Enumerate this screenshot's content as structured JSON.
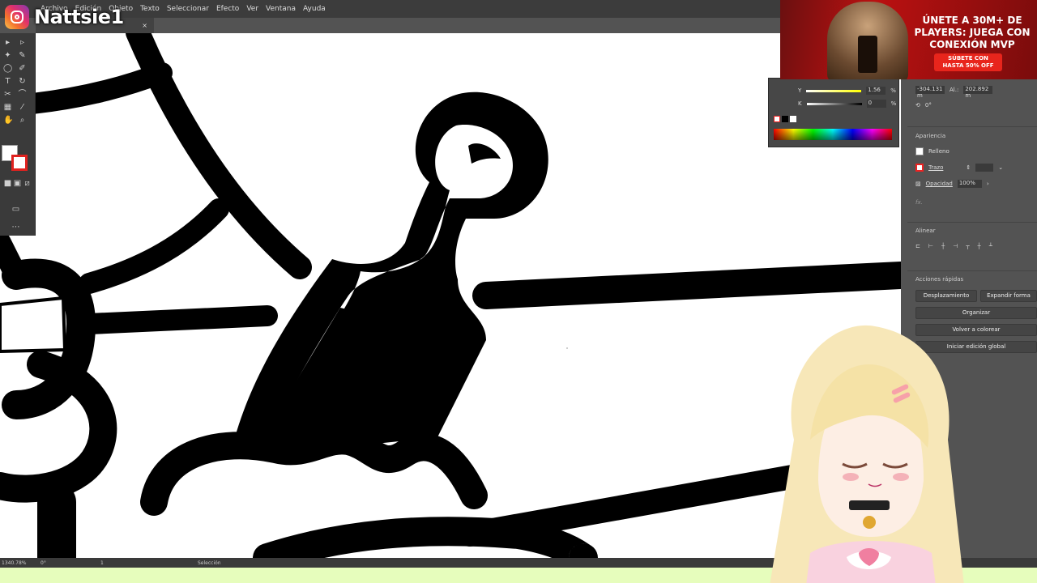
{
  "overlay": {
    "channel_name": "Nattsie1"
  },
  "menubar": {
    "items": [
      "Archivo",
      "Edición",
      "Objeto",
      "Texto",
      "Seleccionar",
      "Efecto",
      "Ver",
      "Ventana",
      "Ayuda"
    ]
  },
  "document_tab": {
    "close": "×"
  },
  "color_panel": {
    "y_label": "Y",
    "k_label": "K",
    "y_value": "1.56",
    "k_value": "0",
    "pct": "%"
  },
  "transform": {
    "x_value": "-304.131 m",
    "al_label": "Al.:",
    "al_value": "202.892 m",
    "angle_value": "0°"
  },
  "properties": {
    "appearance_title": "Apariencia",
    "fill_label": "Relleno",
    "stroke_label": "Trazo",
    "opacity_label": "Opacidad",
    "opacity_value": "100%",
    "fx_label": "fx.",
    "align_title": "Alinear",
    "quick_actions_title": "Acciones rápidas",
    "btn_offset": "Desplazamiento",
    "btn_expand": "Expandir forma",
    "btn_arrange": "Organizar",
    "btn_recolor": "Volver a colorear",
    "btn_global_edit": "Iniciar edición global"
  },
  "ad": {
    "headline": "ÚNETE A 30M+ DE PLAYERS: JUEGA CON CONEXIÓN MVP",
    "cta_line1": "SÚBETE CON",
    "cta_line2": "HASTA 50% OFF"
  },
  "statusbar": {
    "zoom": "1340.78%",
    "rotation": "0°",
    "artboard": "1",
    "tool": "Selección"
  },
  "colors": {
    "stroke_black": "#000000",
    "canvas": "#ffffff",
    "ui_dark": "#535353",
    "ad_red": "#e8251c",
    "bottom_strip": "#e6fdbc"
  },
  "icons": [
    "instagram-icon",
    "selection-tool-icon",
    "pen-tool-icon",
    "type-tool-icon",
    "close-icon",
    "fill-swatch-icon",
    "stroke-swatch-icon",
    "mouse-cursor-icon"
  ]
}
